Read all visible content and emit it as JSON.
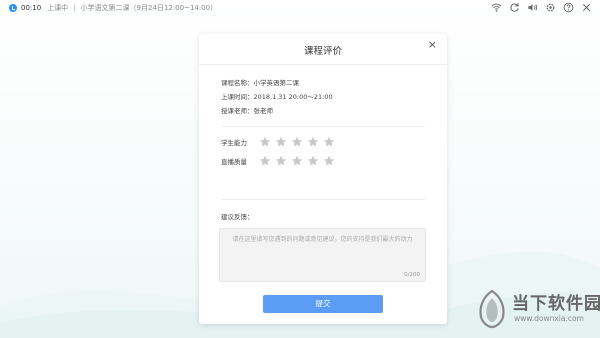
{
  "topbar": {
    "time": "00:10",
    "status": "上课中",
    "separator": "|",
    "course": "小学语文第二课（9月24日12:00~14:00）",
    "icons": [
      "wifi-icon",
      "refresh-icon",
      "volume-icon",
      "settings-icon",
      "help-icon",
      "close-icon"
    ]
  },
  "dialog": {
    "title": "课程评价",
    "close_glyph": "×",
    "course_name": "课程名称：小学英语第二课",
    "class_time": "上课时间：2018.1.31 20:00～21:00",
    "teacher": "授课老师：张老师",
    "ratings": [
      {
        "label": "学生能力",
        "stars": 0,
        "max": 5
      },
      {
        "label": "直播质量",
        "stars": 0,
        "max": 5
      }
    ],
    "feedback_label": "建议反馈：",
    "feedback_value": "",
    "feedback_placeholder": "请在这里填写您遇到的问题或意见建议，您的支持是我们最大的动力",
    "feedback_count": "0/200",
    "submit_label": "提交"
  },
  "colors": {
    "accent": "#5b9cf5",
    "star_empty": "#c8c8c8",
    "live_dot": "#2a8ff7"
  },
  "watermark": {
    "text": "当下软件园",
    "url": "www.downxia.com"
  }
}
